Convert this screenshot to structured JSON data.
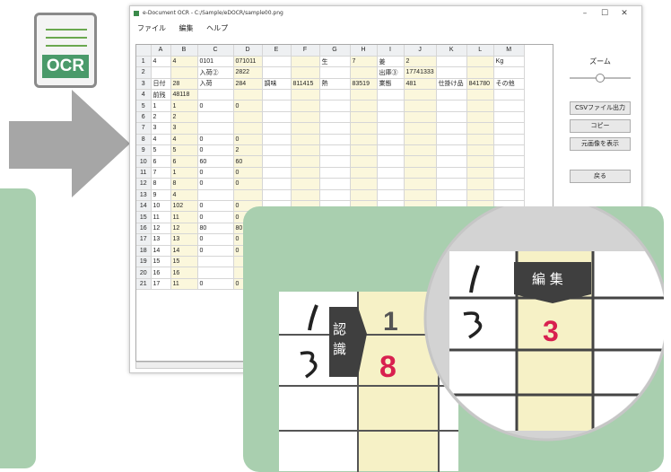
{
  "ocr_icon": {
    "label": "OCR"
  },
  "window": {
    "title": "e-Document OCR - C:/Sample/eDOCR/sample00.png",
    "controls": [
      "–",
      "☐",
      "✕"
    ]
  },
  "menu": [
    "ファイル",
    "編集",
    "ヘルプ"
  ],
  "sheet": {
    "columns": [
      "",
      "A",
      "B",
      "C",
      "D",
      "E",
      "F",
      "G",
      "H",
      "I",
      "J",
      "K",
      "L",
      "M"
    ],
    "rows": [
      [
        "1",
        "4",
        "4",
        "0101",
        "071011",
        "",
        "",
        "生",
        "7",
        "姜",
        "2",
        "",
        "",
        "Kg"
      ],
      [
        "2",
        "",
        "",
        "入荷②",
        "2822",
        "",
        "",
        "",
        "",
        "出庫③",
        "17741333",
        "",
        "",
        ""
      ],
      [
        "3",
        "日付",
        "28",
        "入荷",
        "284",
        "調味",
        "811415",
        "熱",
        "83519",
        "業態",
        "481",
        "仕掛け品",
        "841780",
        "その他"
      ],
      [
        "4",
        "前残",
        "48118",
        "",
        "",
        "",
        "",
        "",
        "",
        "",
        "",
        "",
        "",
        ""
      ],
      [
        "5",
        "1",
        "1",
        "0",
        "0",
        "",
        "",
        "",
        "",
        "",
        "",
        "",
        "",
        ""
      ],
      [
        "6",
        "2",
        "2",
        "",
        "",
        "",
        "",
        "",
        "",
        "",
        "",
        "",
        "",
        ""
      ],
      [
        "7",
        "3",
        "3",
        "",
        "",
        "",
        "",
        "",
        "",
        "",
        "",
        "",
        "",
        ""
      ],
      [
        "8",
        "4",
        "4",
        "0",
        "0",
        "",
        "",
        "",
        "",
        "",
        "",
        "",
        "",
        ""
      ],
      [
        "9",
        "5",
        "5",
        "0",
        "2",
        "",
        "",
        "",
        "",
        "",
        "",
        "",
        "",
        ""
      ],
      [
        "10",
        "6",
        "6",
        "60",
        "60",
        "",
        "",
        "",
        "",
        "",
        "",
        "",
        "",
        ""
      ],
      [
        "11",
        "7",
        "1",
        "0",
        "0",
        "",
        "",
        "",
        "",
        "",
        "",
        "",
        "",
        ""
      ],
      [
        "12",
        "8",
        "8",
        "0",
        "0",
        "",
        "",
        "",
        "",
        "",
        "",
        "",
        "",
        ""
      ],
      [
        "13",
        "9",
        "4",
        "",
        "",
        "",
        "",
        "",
        "",
        "",
        "",
        "",
        "",
        ""
      ],
      [
        "14",
        "10",
        "102",
        "0",
        "0",
        "",
        "",
        "",
        "",
        "",
        "",
        "",
        "",
        ""
      ],
      [
        "15",
        "11",
        "11",
        "0",
        "0",
        "",
        "",
        "",
        "",
        "",
        "",
        "",
        "",
        ""
      ],
      [
        "16",
        "12",
        "12",
        "80",
        "80",
        "",
        "",
        "",
        "",
        "",
        "",
        "",
        "",
        ""
      ],
      [
        "17",
        "13",
        "13",
        "0",
        "0",
        "",
        "",
        "",
        "",
        "",
        "",
        "",
        "",
        ""
      ],
      [
        "18",
        "14",
        "14",
        "0",
        "0",
        "",
        "",
        "",
        "",
        "",
        "",
        "",
        "",
        ""
      ],
      [
        "19",
        "15",
        "15",
        "",
        "",
        "",
        "",
        "",
        "",
        "",
        "",
        "",
        "",
        ""
      ],
      [
        "20",
        "16",
        "16",
        "",
        "",
        "",
        "",
        "",
        "",
        "",
        "",
        "",
        "",
        ""
      ],
      [
        "21",
        "17",
        "11",
        "0",
        "0",
        "",
        "",
        "",
        "",
        "",
        "",
        "",
        "",
        ""
      ]
    ]
  },
  "sidebar": {
    "zoom_label": "ズーム",
    "zoom_level": 0.42,
    "csv_button": "CSVファイル出力",
    "copy_button": "コピー",
    "show_original_button": "元画像を表示",
    "back_button": "戻る"
  },
  "callout": {
    "recognize_tag": "認識",
    "edit_tag": "編 集",
    "value_before": "1",
    "value_after": "8",
    "value_edited": "3",
    "accent_color": "#d8204f"
  }
}
